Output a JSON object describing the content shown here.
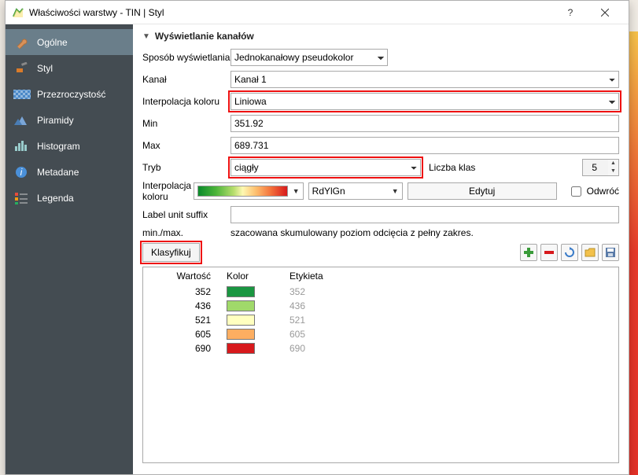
{
  "window": {
    "title": "Właściwości warstwy - TIN | Styl"
  },
  "sidebar": {
    "items": [
      {
        "label": "Ogólne"
      },
      {
        "label": "Styl"
      },
      {
        "label": "Przezroczystość"
      },
      {
        "label": "Piramidy"
      },
      {
        "label": "Histogram"
      },
      {
        "label": "Metadane"
      },
      {
        "label": "Legenda"
      }
    ]
  },
  "section": {
    "title": "Wyświetlanie kanałów"
  },
  "form": {
    "render_label": "Sposób wyświetlania",
    "render_value": "Jednokanałowy pseudokolor",
    "band_label": "Kanał",
    "band_value": "Kanał 1",
    "interp_label": "Interpolacja koloru",
    "interp_value": "Liniowa",
    "min_label": "Min",
    "min_value": "351.92",
    "max_label": "Max",
    "max_value": "689.731",
    "mode_label": "Tryb",
    "mode_value": "ciągły",
    "classcount_label": "Liczba klas",
    "classcount_value": "5",
    "colormap_label": "Interpolacja koloru",
    "ramp_name": "RdYlGn",
    "edit_label": "Edytuj",
    "invert_label": "Odwróć",
    "suffix_label": "Label unit suffix",
    "suffix_value": "",
    "minmax_label": "min./max.",
    "minmax_text": "szacowana skumulowany poziom odcięcia z pełny zakres.",
    "classify_label": "Klasyfikuj",
    "table": {
      "h_value": "Wartość",
      "h_color": "Kolor",
      "h_label": "Etykieta",
      "rows": [
        {
          "v": "352",
          "c": "#1a9641",
          "l": "352"
        },
        {
          "v": "436",
          "c": "#a0d96a",
          "l": "436"
        },
        {
          "v": "521",
          "c": "#ffffbf",
          "l": "521"
        },
        {
          "v": "605",
          "c": "#fdae61",
          "l": "605"
        },
        {
          "v": "690",
          "c": "#d7191c",
          "l": "690"
        }
      ]
    }
  }
}
